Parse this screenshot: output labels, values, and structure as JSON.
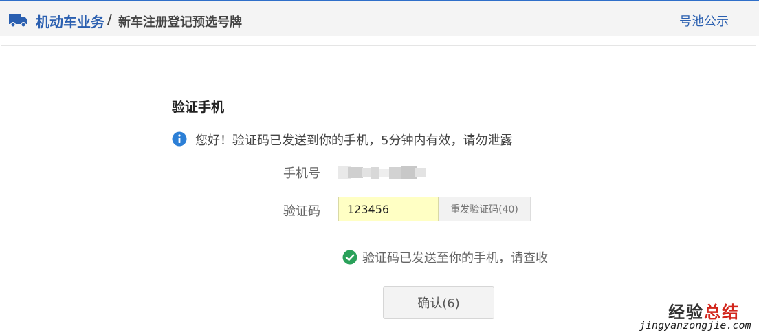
{
  "header": {
    "breadcrumb_main": "机动车业务",
    "breadcrumb_separator": "/",
    "breadcrumb_sub": "新车注册登记预选号牌",
    "pool_link": "号池公示",
    "truck_icon": "truck-icon"
  },
  "form": {
    "title": "验证手机",
    "info_message": "您好！验证码已发送到你的手机，5分钟内有效，请勿泄露",
    "phone_label": "手机号",
    "code_label": "验证码",
    "code_value": "123456",
    "resend_label": "重发验证码(40)",
    "sent_message": "验证码已发送至你的手机，请查收",
    "confirm_label": "确认(6)"
  },
  "watermark": {
    "title_part1": "经验",
    "title_part2": "总结",
    "url": "jingyanzongjie.com"
  },
  "colors": {
    "accent": "#2a5fb0",
    "info_icon": "#2c7fd6",
    "success_icon": "#2aa15a",
    "input_bg": "#ffffc4"
  }
}
